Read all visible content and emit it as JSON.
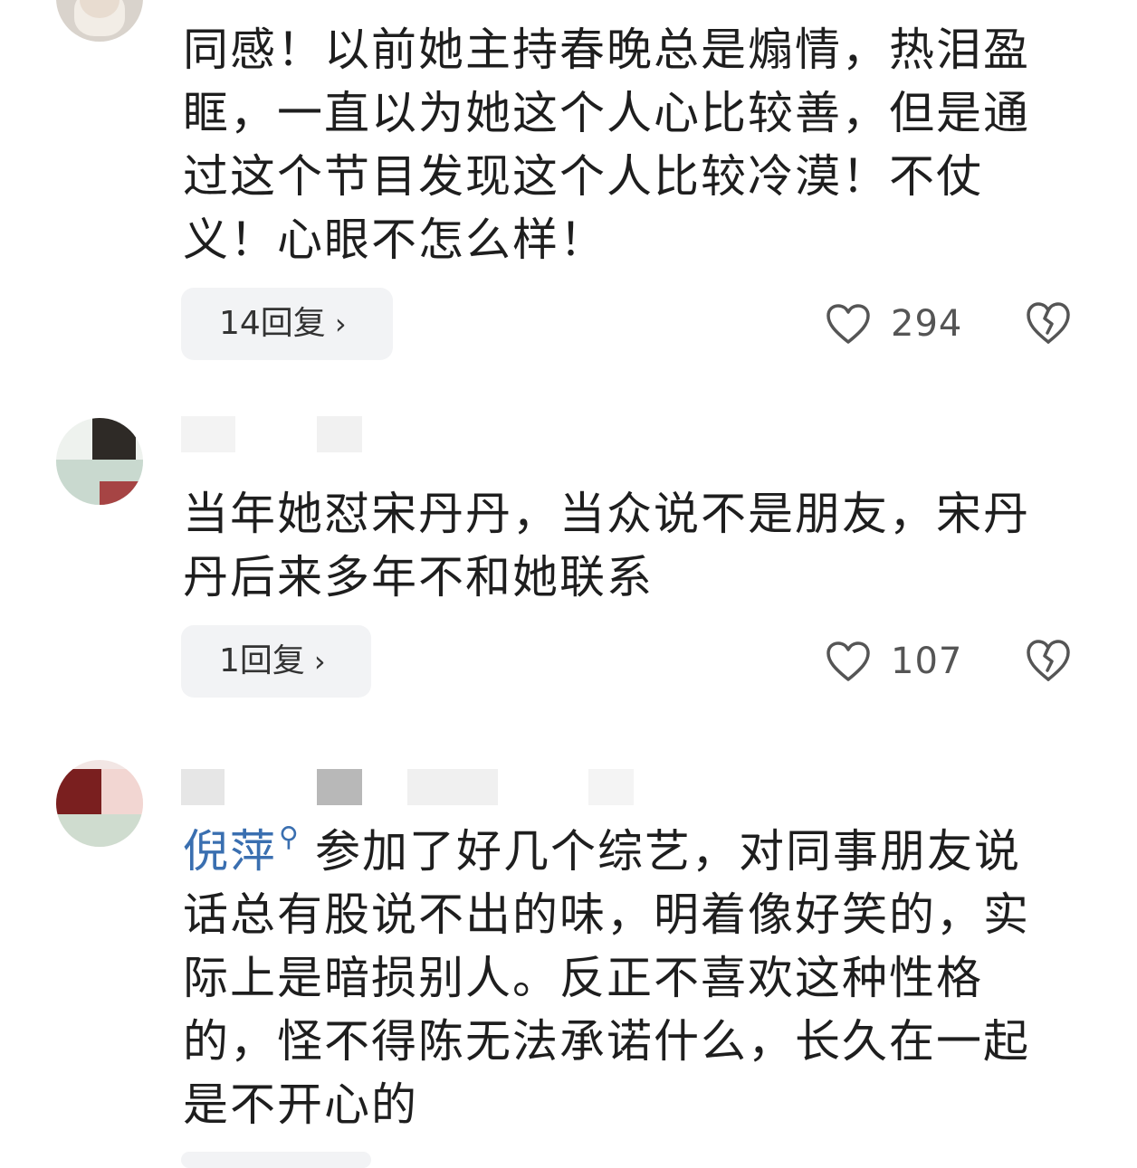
{
  "comments": [
    {
      "text": "同感！以前她主持春晚总是煽情，热泪盈眶，一直以为她这个人心比较善，但是通过这个节目发现这个人比较冷漠！不仗义！心眼不怎么样！",
      "lines": [
        "同感！以前她主持春晚总是煽情，热泪盈",
        "眶，一直以为她这个人心比较善，但是通",
        "过这个节目发现这个人比较冷漠！不仗",
        "义！心眼不怎么样！"
      ],
      "reply_label": "14回复",
      "likes": "294"
    },
    {
      "text": "当年她怼宋丹丹，当众说不是朋友，宋丹丹后来多年不和她联系",
      "lines": [
        "当年她怼宋丹丹，当众说不是朋友，宋丹",
        "丹后来多年不和她联系"
      ],
      "reply_label": "1回复",
      "likes": "107"
    },
    {
      "mention": "倪萍",
      "lines": [
        "参加了好几个综艺，对同事朋友说",
        "话总有股说不出的味，明着像好笑的，实",
        "际上是暗损别人。反正不喜欢这种性格",
        "的，怪不得陈无法承诺什么，长久在一起",
        "是不开心的"
      ]
    }
  ],
  "icons": {
    "like": "heart-outline-icon",
    "dislike": "broken-heart-icon",
    "reply_chevron": "chevron-right-icon",
    "mention": "search-icon"
  },
  "colors": {
    "text": "#1e1e1e",
    "mention": "#3a6fb0",
    "pill_bg": "#f2f3f5",
    "icon": "#555555"
  }
}
